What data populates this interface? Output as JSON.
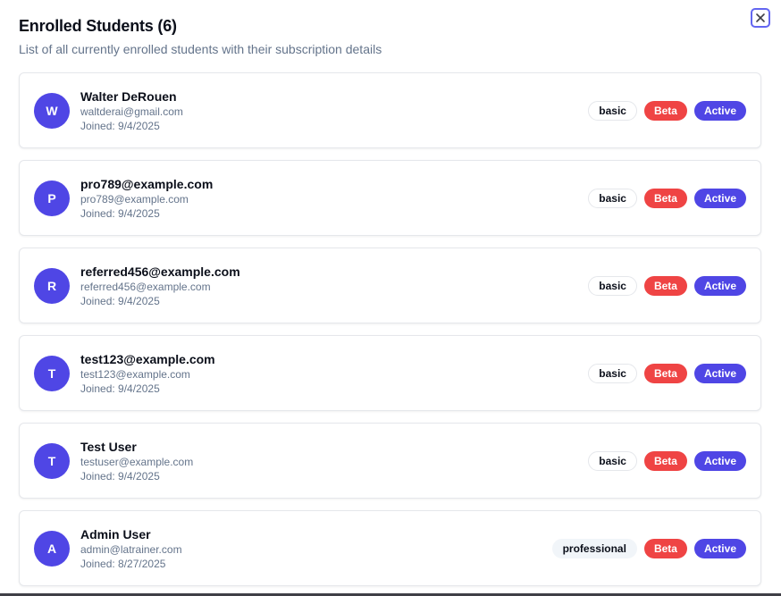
{
  "dialog": {
    "title": "Enrolled Students (6)",
    "subtitle": "List of all currently enrolled students with their subscription details",
    "close_icon": "close-icon"
  },
  "colors": {
    "accent": "#4f46e5",
    "beta_badge": "#ef4444",
    "text_muted": "#64748b"
  },
  "students": [
    {
      "initial": "W",
      "name": "Walter DeRouen",
      "email": "waltderai@gmail.com",
      "joined": "Joined: 9/4/2025",
      "plan": "basic",
      "beta": "Beta",
      "status": "Active"
    },
    {
      "initial": "P",
      "name": "pro789@example.com",
      "email": "pro789@example.com",
      "joined": "Joined: 9/4/2025",
      "plan": "basic",
      "beta": "Beta",
      "status": "Active"
    },
    {
      "initial": "R",
      "name": "referred456@example.com",
      "email": "referred456@example.com",
      "joined": "Joined: 9/4/2025",
      "plan": "basic",
      "beta": "Beta",
      "status": "Active"
    },
    {
      "initial": "T",
      "name": "test123@example.com",
      "email": "test123@example.com",
      "joined": "Joined: 9/4/2025",
      "plan": "basic",
      "beta": "Beta",
      "status": "Active"
    },
    {
      "initial": "T",
      "name": "Test User",
      "email": "testuser@example.com",
      "joined": "Joined: 9/4/2025",
      "plan": "basic",
      "beta": "Beta",
      "status": "Active"
    },
    {
      "initial": "A",
      "name": "Admin User",
      "email": "admin@latrainer.com",
      "joined": "Joined: 8/27/2025",
      "plan": "professional",
      "beta": "Beta",
      "status": "Active"
    }
  ]
}
